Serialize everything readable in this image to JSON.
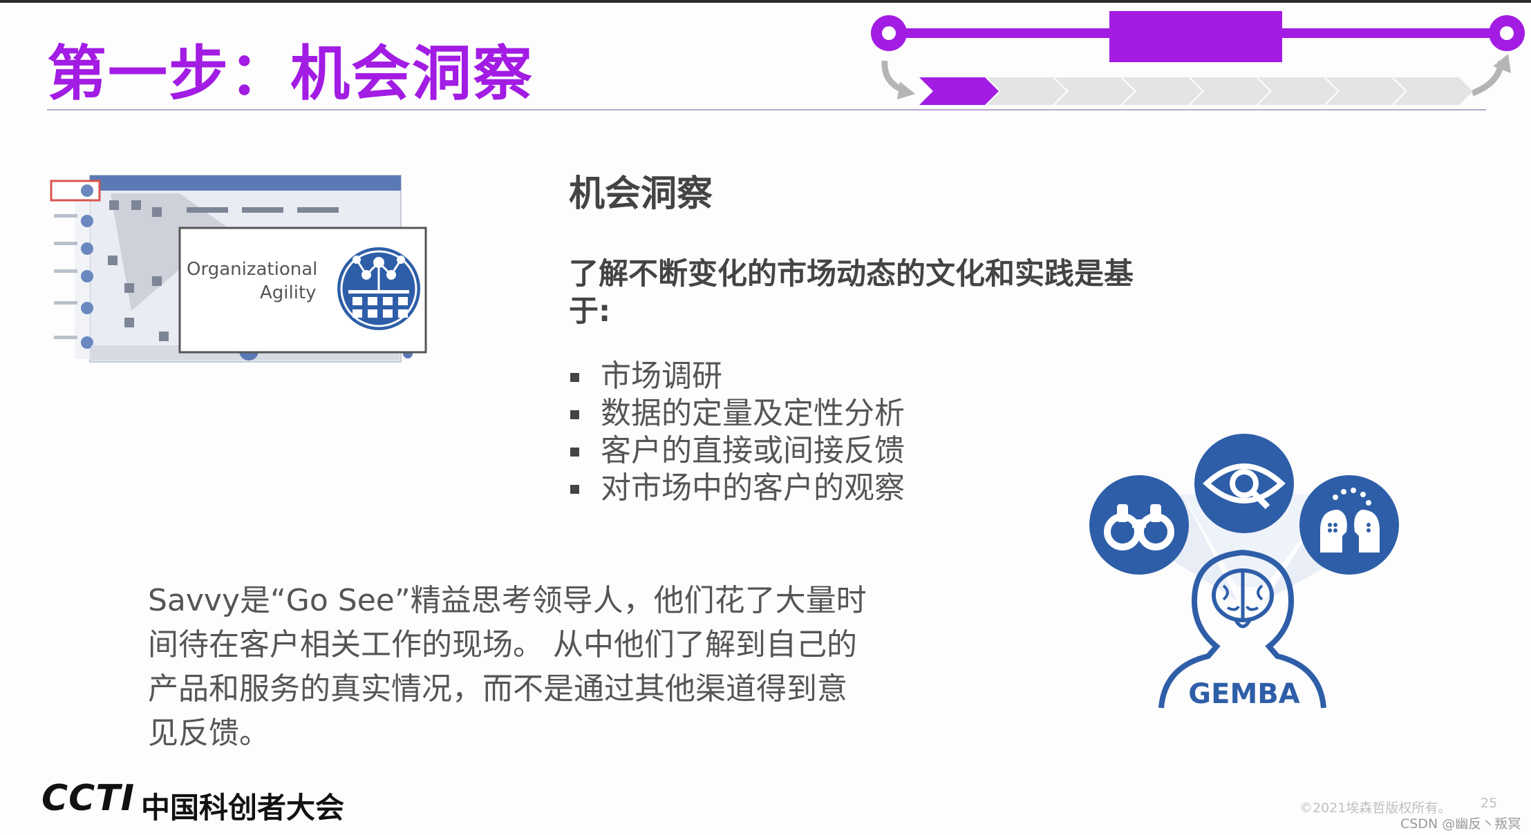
{
  "slide": {
    "title": "第一步：机会洞察",
    "accent_color": "#a21ce3"
  },
  "thumbnail": {
    "caption_line1": "Organizational",
    "caption_line2": "Agility",
    "icon": "org-network-icon"
  },
  "content": {
    "heading": "机会洞察",
    "intro": "了解不断变化的市场动态的文化和实践是基于:",
    "bullets": [
      "市场调研",
      "数据的定量及定性分析",
      "客户的直接或间接反馈",
      "对市场中的客户的观察"
    ],
    "savvy_paragraph": "Savvy是“Go See”精益思考领导人，他们花了大量时间待在客户相关工作的现场。 从中他们了解到自己的产品和服务的真实情况，而不是通过其他渠道得到意见反馈。"
  },
  "gemba": {
    "label": "GEMBA",
    "icons": [
      "binoculars-icon",
      "eye-search-icon",
      "people-thinking-icon",
      "brain-head-icon"
    ],
    "circle_color": "#2e5ea8"
  },
  "footer": {
    "logo": "CCTI",
    "org": "中国科创者大会",
    "copyright": "©2021埃森哲版权所有。",
    "page_number": "25",
    "watermark": "CSDN @幽反丶叛冥"
  }
}
